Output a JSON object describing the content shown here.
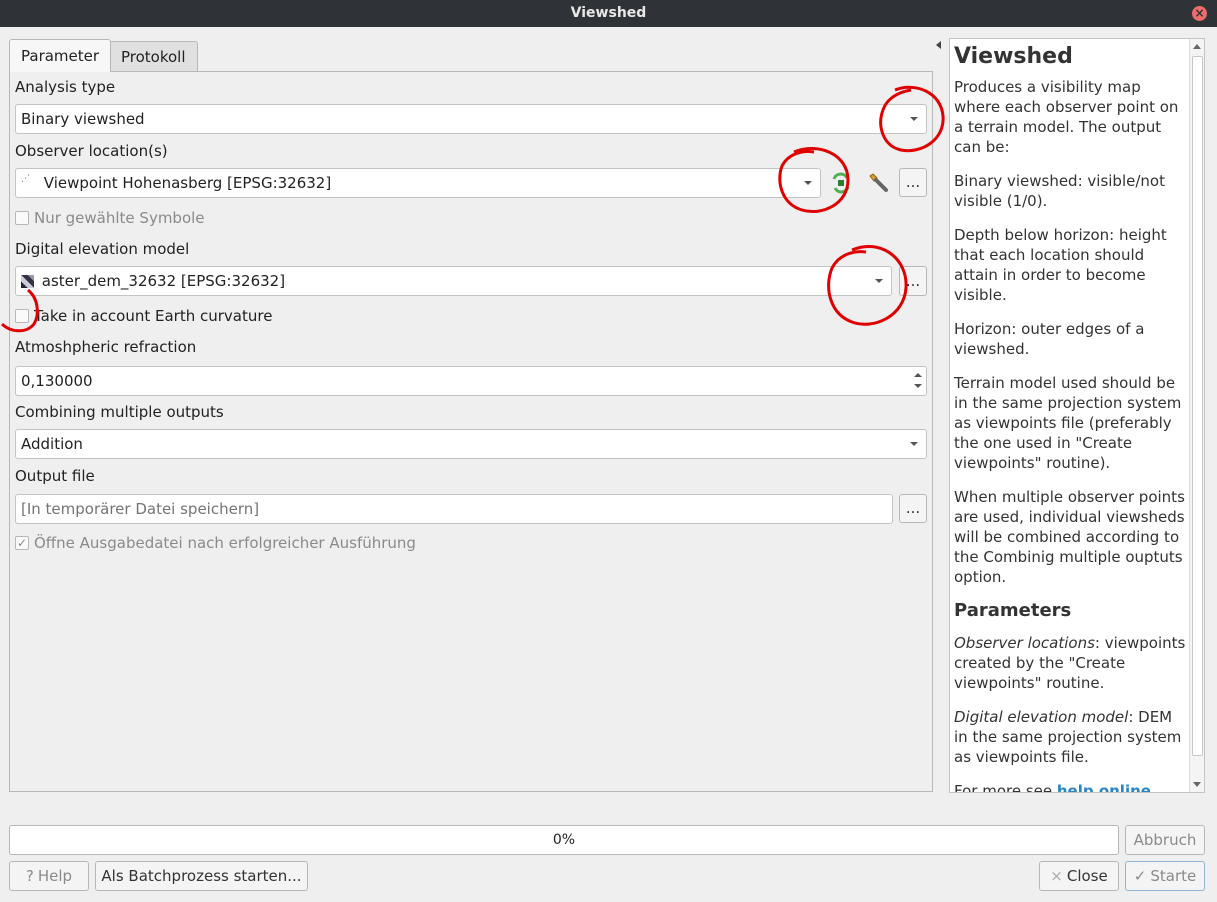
{
  "window": {
    "title": "Viewshed"
  },
  "tabs": [
    {
      "label": "Parameter"
    },
    {
      "label": "Protokoll"
    }
  ],
  "form": {
    "analysis_type": {
      "label": "Analysis type",
      "value": "Binary viewshed"
    },
    "observer": {
      "label": "Observer location(s)",
      "value": "Viewpoint Hohenasberg [EPSG:32632]",
      "selected_only_label": "Nur gewählte Symbole"
    },
    "dem": {
      "label": "Digital elevation model",
      "value": "aster_dem_32632 [EPSG:32632]"
    },
    "curvature": {
      "label": "Take in account Earth curvature",
      "checked": false
    },
    "refraction": {
      "label": "Atmoshpheric refraction",
      "value": "0,130000"
    },
    "combining": {
      "label": "Combining multiple outputs",
      "value": "Addition"
    },
    "output": {
      "label": "Output file",
      "placeholder": "[In temporärer Datei speichern]",
      "open_label": "Öffne Ausgabedatei nach erfolgreicher Ausführung",
      "open_checked": true
    },
    "browse_label": "..."
  },
  "help": {
    "title": "Viewshed",
    "p1": "Produces a visibility map where each observer point on a terrain model. The output can be:",
    "p2": "Binary viewshed: visible/not visible (1/0).",
    "p3": "Depth below horizon: height that each location should attain in order to become visible.",
    "p4": "Horizon: outer edges of a viewshed.",
    "p5": "Terrain model used should be in the same projection system as viewpoints file (preferably the one used in \"Create viewpoints\" routine).",
    "p6": "When multiple observer points are used, individual viewsheds will be combined according to the Combinig multiple ouptuts option.",
    "params_title": "Parameters",
    "obs_term": "Observer locations",
    "obs_text": ": viewpoints created by the \"Create viewpoints\" routine.",
    "dem_term": "Digital elevation model",
    "dem_text": ": DEM in the same projection system as viewpoints file.",
    "more_prefix": "For more see ",
    "more_link": "help online",
    "more_suffix": "."
  },
  "progress": {
    "text": "0%",
    "value": 0
  },
  "buttons": {
    "cancel": "Abbruch",
    "help": "Help",
    "batch": "Als Batchprozess starten...",
    "close": "Close",
    "start": "Starte"
  },
  "colors": {
    "annotation": "#e00000",
    "link": "#2b84c4",
    "titlebar": "#2f3338"
  }
}
